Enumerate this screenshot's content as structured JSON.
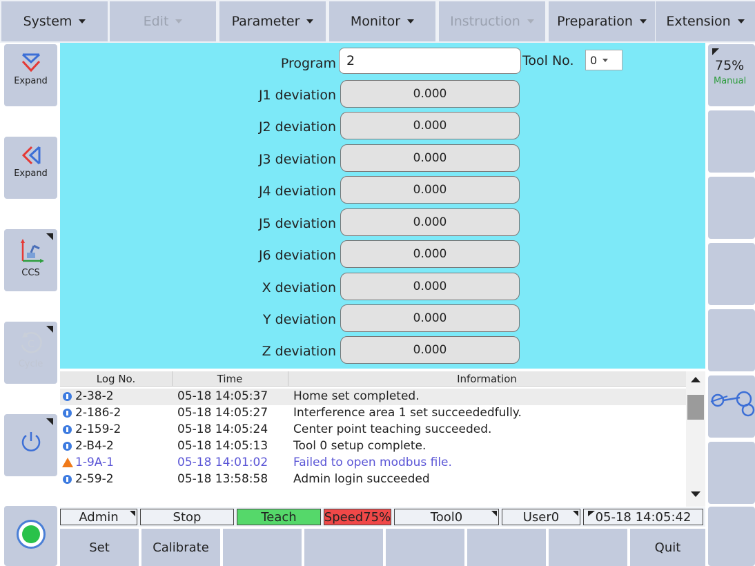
{
  "menu": [
    {
      "label": "System",
      "disabled": false
    },
    {
      "label": "Edit",
      "disabled": true
    },
    {
      "label": "Parameter",
      "disabled": false
    },
    {
      "label": "Monitor",
      "disabled": false
    },
    {
      "label": "Instruction",
      "disabled": true
    },
    {
      "label": "Preparation",
      "disabled": false
    },
    {
      "label": "Extension",
      "disabled": false
    }
  ],
  "left_buttons": {
    "expand_down": "Expand",
    "expand_left": "Expand",
    "coord": "CCS",
    "cycle": "Cycle"
  },
  "form": {
    "program_label": "Program",
    "program_value": "2",
    "tool_label": "Tool No.",
    "tool_value": "0",
    "deviations": [
      {
        "label": "J1 deviation",
        "value": "0.000"
      },
      {
        "label": "J2 deviation",
        "value": "0.000"
      },
      {
        "label": "J3 deviation",
        "value": "0.000"
      },
      {
        "label": "J4 deviation",
        "value": "0.000"
      },
      {
        "label": "J5 deviation",
        "value": "0.000"
      },
      {
        "label": "J6 deviation",
        "value": "0.000"
      },
      {
        "label": "X deviation",
        "value": "0.000"
      },
      {
        "label": "Y deviation",
        "value": "0.000"
      },
      {
        "label": "Z deviation",
        "value": "0.000"
      }
    ]
  },
  "log": {
    "headers": {
      "no": "Log No.",
      "time": "Time",
      "info": "Information"
    },
    "rows": [
      {
        "no": "2-38-2",
        "time": "05-18 14:05:37",
        "info": "Home set completed.",
        "type": "info"
      },
      {
        "no": "2-186-2",
        "time": "05-18 14:05:27",
        "info": "Interference area 1 set succeededfully.",
        "type": "info"
      },
      {
        "no": "2-159-2",
        "time": "05-18 14:05:24",
        "info": "Center point teaching succeeded.",
        "type": "info"
      },
      {
        "no": "2-B4-2",
        "time": "05-18 14:05:13",
        "info": "Tool 0 setup complete.",
        "type": "info"
      },
      {
        "no": "1-9A-1",
        "time": "05-18 14:01:02",
        "info": "Failed to open modbus file.",
        "type": "warning"
      },
      {
        "no": "2-59-2",
        "time": "05-18 13:58:58",
        "info": "Admin  login succeeded",
        "type": "info"
      }
    ]
  },
  "status": {
    "user": "Admin",
    "run_state": "Stop",
    "mode": "Teach",
    "speed": "Speed75%",
    "tool": "Tool0",
    "coord_user": "User0",
    "datetime": "05-18 14:05:42"
  },
  "bottom": {
    "set": "Set",
    "calibrate": "Calibrate",
    "quit": "Quit"
  },
  "speed_panel": {
    "percent": "75%",
    "mode": "Manual"
  },
  "colors": {
    "panel": "#7de9f8",
    "button": "#c3cbdd",
    "teach": "#55d86a",
    "speed": "#f04848",
    "warning_text": "#5a55d6",
    "lamp": "#29c24a"
  }
}
